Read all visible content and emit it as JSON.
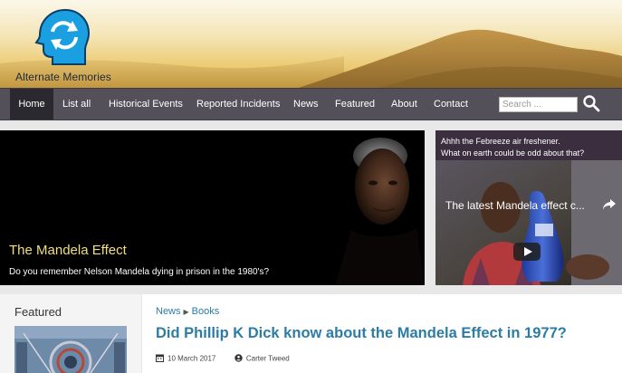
{
  "site": {
    "logo_icon": "sync-head-icon",
    "name": "Alternate Memories"
  },
  "nav": {
    "items": [
      {
        "label": "Home",
        "active": true
      },
      {
        "label": "List all"
      },
      {
        "label": "Historical Events"
      },
      {
        "label": "Reported Incidents"
      },
      {
        "label": "News"
      },
      {
        "label": "Featured"
      },
      {
        "label": "About"
      },
      {
        "label": "Contact"
      }
    ],
    "search_placeholder": "Search ...",
    "search_icon": "search-icon"
  },
  "hero": {
    "title": "The Mandela Effect",
    "subtitle": "Do you remember Nelson Mandela dying in prison in the 1980's?"
  },
  "side": {
    "caption_line1": "Ahhh the Febreeze air freshener.",
    "caption_line2": "What on earth could be odd about that?",
    "video_title": "The latest Mandela effect c...",
    "share_icon": "share-icon",
    "play_icon": "play-icon"
  },
  "featured": {
    "label": "Featured"
  },
  "article": {
    "category1": "News",
    "category2": "Books",
    "title": "Did Phillip K Dick know about the Mandela Effect in 1977?",
    "date": "10 March 2017",
    "author": "Carter Tweed"
  },
  "colors": {
    "nav_bg": "#54505a",
    "nav_active": "#2b2930",
    "link": "#2c7ca5",
    "hero_title": "#f4df7a",
    "logo_blue": "#1aa0e0"
  }
}
